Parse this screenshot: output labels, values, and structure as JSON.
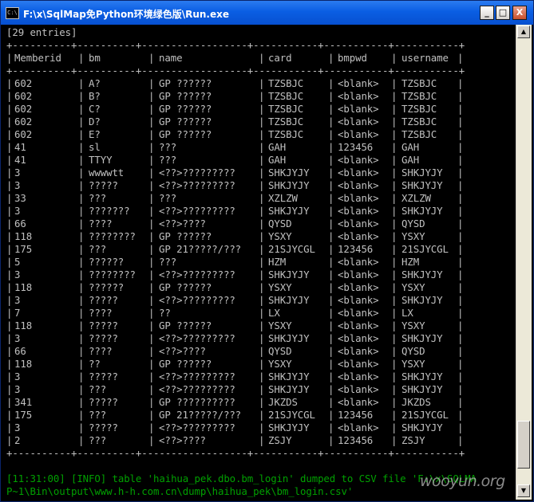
{
  "window": {
    "title": "F:\\x\\SqlMap免Python环境绿色版\\Run.exe",
    "app_icon": "cmd-icon",
    "app_icon_text": "C:\\",
    "minimize_label": "_",
    "maximize_label": "□",
    "close_label": "X"
  },
  "console": {
    "header": "[29 entries]",
    "separator": "+----------+----------+------------------+-----------+-----------+-----------+",
    "columns": [
      "Memberid",
      "bm",
      "name",
      "card",
      "bmpwd",
      "username"
    ],
    "rows": [
      [
        "602",
        "A?",
        "GP ??????",
        "TZSBJC",
        "<blank>",
        "TZSBJC"
      ],
      [
        "602",
        "B?",
        "GP ??????",
        "TZSBJC",
        "<blank>",
        "TZSBJC"
      ],
      [
        "602",
        "C?",
        "GP ??????",
        "TZSBJC",
        "<blank>",
        "TZSBJC"
      ],
      [
        "602",
        "D?",
        "GP ??????",
        "TZSBJC",
        "<blank>",
        "TZSBJC"
      ],
      [
        "602",
        "E?",
        "GP ??????",
        "TZSBJC",
        "<blank>",
        "TZSBJC"
      ],
      [
        "41",
        "sl",
        "???",
        "GAH",
        "123456",
        "GAH"
      ],
      [
        "41",
        "TTYY",
        "???",
        "GAH",
        "<blank>",
        "GAH"
      ],
      [
        "3",
        "wwwwtt",
        "<??>?????????",
        "SHKJYJY",
        "<blank>",
        "SHKJYJY"
      ],
      [
        "3",
        "?????",
        "<??>?????????",
        "SHKJYJY",
        "<blank>",
        "SHKJYJY"
      ],
      [
        "33",
        "???",
        "???",
        "XZLZW",
        "<blank>",
        "XZLZW"
      ],
      [
        "3",
        "???????",
        "<??>?????????",
        "SHKJYJY",
        "<blank>",
        "SHKJYJY"
      ],
      [
        "66",
        "????",
        "<??>????",
        "QYSD",
        "<blank>",
        "QYSD"
      ],
      [
        "118",
        "????????",
        "GP ??????",
        "YSXY",
        "<blank>",
        "YSXY"
      ],
      [
        "175",
        "???",
        "GP 21?????/???",
        "21SJYCGL",
        "123456",
        "21SJYCGL"
      ],
      [
        "5",
        "??????",
        "???",
        "HZM",
        "<blank>",
        "HZM"
      ],
      [
        "3",
        "????????",
        "<??>?????????",
        "SHKJYJY",
        "<blank>",
        "SHKJYJY"
      ],
      [
        "118",
        "??????",
        "GP ??????",
        "YSXY",
        "<blank>",
        "YSXY"
      ],
      [
        "3",
        "?????",
        "<??>?????????",
        "SHKJYJY",
        "<blank>",
        "SHKJYJY"
      ],
      [
        "7",
        "????",
        "??",
        "LX",
        "<blank>",
        "LX"
      ],
      [
        "118",
        "?????",
        "GP ??????",
        "YSXY",
        "<blank>",
        "YSXY"
      ],
      [
        "3",
        "?????",
        "<??>?????????",
        "SHKJYJY",
        "<blank>",
        "SHKJYJY"
      ],
      [
        "66",
        "????",
        "<??>????",
        "QYSD",
        "<blank>",
        "QYSD"
      ],
      [
        "118",
        "??",
        "GP ??????",
        "YSXY",
        "<blank>",
        "YSXY"
      ],
      [
        "3",
        "?????",
        "<??>?????????",
        "SHKJYJY",
        "<blank>",
        "SHKJYJY"
      ],
      [
        "3",
        "???",
        "<??>?????????",
        "SHKJYJY",
        "<blank>",
        "SHKJYJY"
      ],
      [
        "341",
        "?????",
        "GP ??????????",
        "JKZDS",
        "<blank>",
        "JKZDS"
      ],
      [
        "175",
        "???",
        "GP 21?????/???",
        "21SJYCGL",
        "123456",
        "21SJYCGL"
      ],
      [
        "3",
        "?????",
        "<??>?????????",
        "SHKJYJY",
        "<blank>",
        "SHKJYJY"
      ],
      [
        "2",
        "???",
        "<??>????",
        "ZSJY",
        "123456",
        "ZSJY"
      ]
    ],
    "log_line_1": "[11:31:00] [INFO] table 'haihua_pek.dbo.bm_login' dumped to CSV file 'F:\\x\\SQLMA",
    "log_line_2": "P~1\\Bin\\output\\www.h-h.com.cn\\dump\\haihua_pek\\bm_login.csv'"
  },
  "scrollbar": {
    "up_label": "▲",
    "down_label": "▼"
  },
  "watermark": "wooyun.org"
}
